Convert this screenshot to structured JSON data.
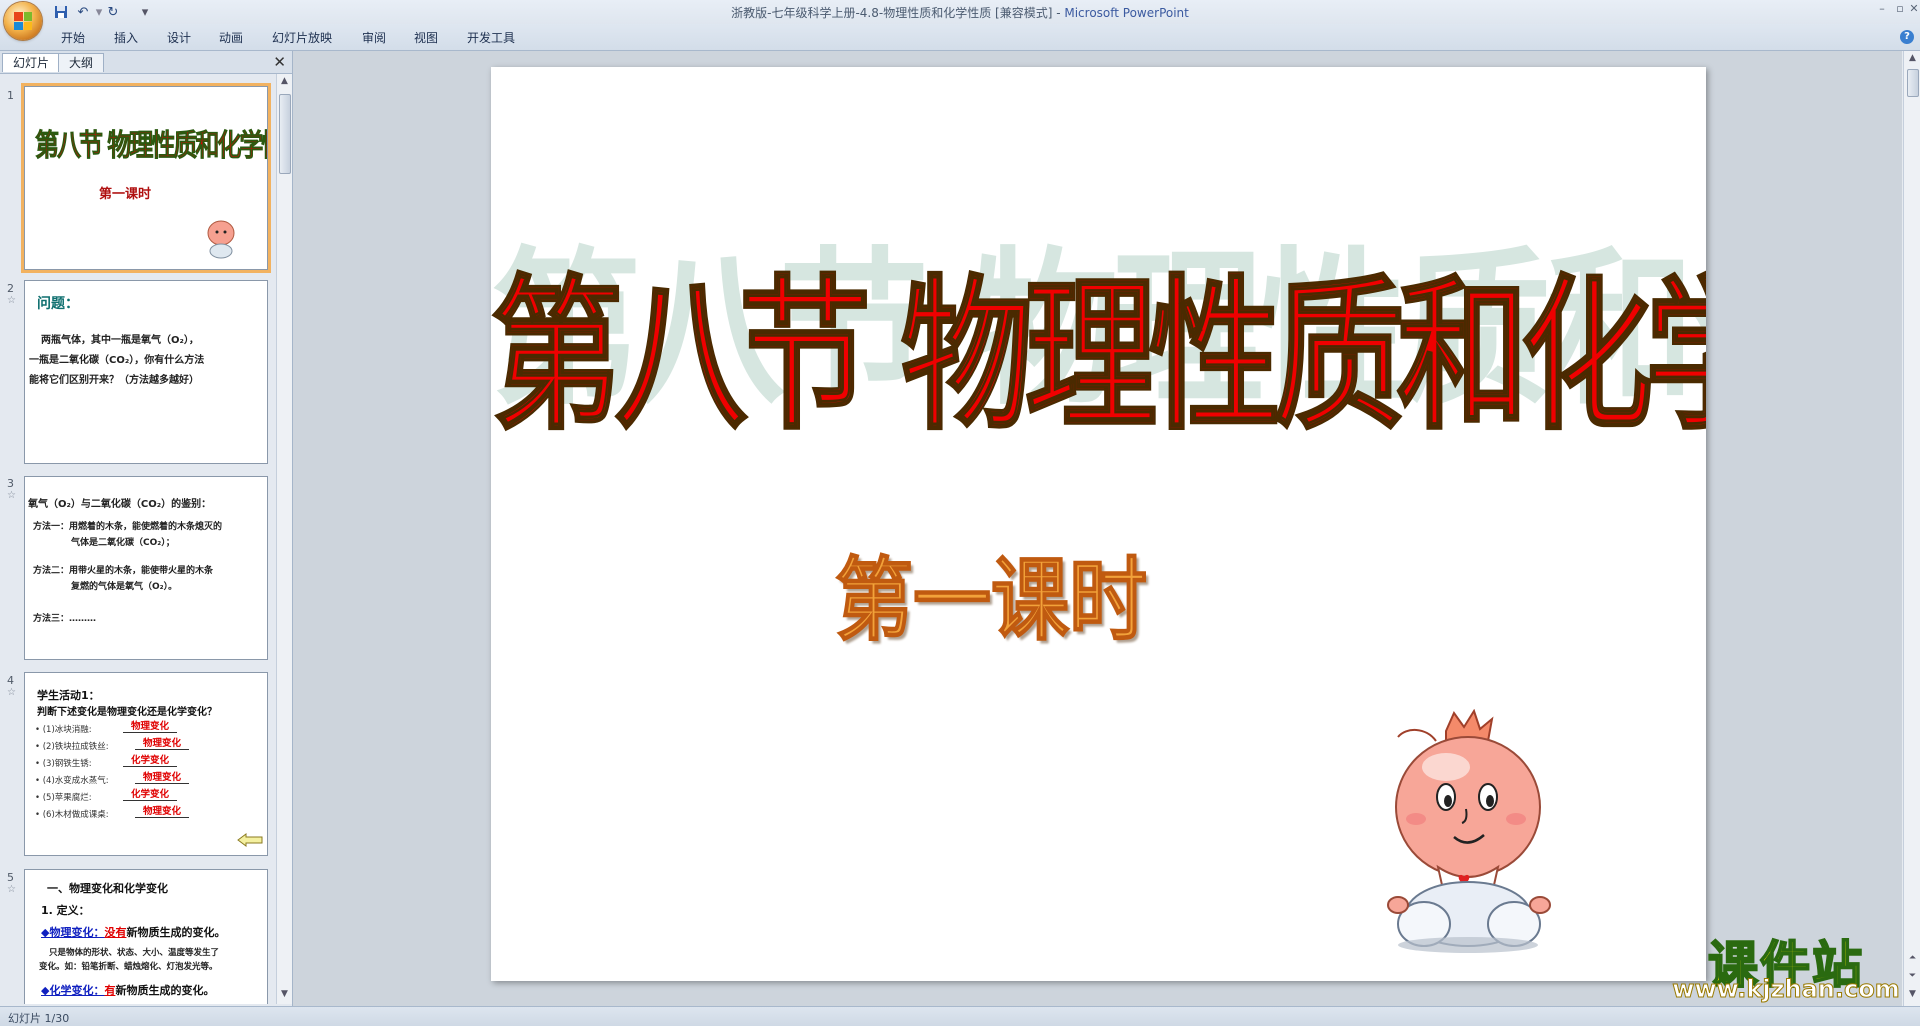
{
  "window": {
    "title": "浙教版-七年级科学上册-4.8-物理性质和化学性质 [兼容模式] - ",
    "app_name": "Microsoft PowerPoint",
    "qat": [
      "save-icon",
      "undo-icon",
      "redo-icon",
      "customize-icon"
    ]
  },
  "ribbon": {
    "tabs": [
      "开始",
      "插入",
      "设计",
      "动画",
      "幻灯片放映",
      "审阅",
      "视图",
      "开发工具"
    ]
  },
  "panel": {
    "tabs": [
      "幻灯片",
      "大纲"
    ],
    "close": "✕"
  },
  "thumbnails": [
    {
      "number": "1",
      "title": "第八节  物理性质和化学性质",
      "subtitle": "第一课时"
    },
    {
      "number": "2",
      "heading": "问题：",
      "lines": [
        "两瓶气体，其中一瓶是氧气（O₂），",
        "一瓶是二氧化碳（CO₂），你有什么方法",
        "能将它们区别开来？（方法越多越好）"
      ]
    },
    {
      "number": "3",
      "heading": "氧气（O₂）与二氧化碳（CO₂）的鉴别：",
      "lines": [
        "方法一：用燃着的木条，能使燃着的木条熄灭的",
        "气体是二氧化碳（CO₂）；",
        "方法二：用带火星的木条，能使带火星的木条",
        "复燃的气体是氧气（O₂）。",
        "方法三：………"
      ]
    },
    {
      "number": "4",
      "heading": "学生活动1：",
      "question": "判断下述变化是物理变化还是化学变化？",
      "items": [
        {
          "q": "(1)冰块消融:",
          "a": "物理变化"
        },
        {
          "q": "(2)铁块拉成铁丝:",
          "a": "物理变化"
        },
        {
          "q": "(3)钢铁生锈:",
          "a": "化学变化"
        },
        {
          "q": "(4)水变成水蒸气:",
          "a": "物理变化"
        },
        {
          "q": "(5)苹果腐烂:",
          "a": "化学变化"
        },
        {
          "q": "(6)木材做成课桌:",
          "a": "物理变化"
        }
      ]
    },
    {
      "number": "5",
      "heading": "一、物理变化和化学变化",
      "sub": "1. 定义：",
      "physical": "◆物理变化：",
      "physical_key": "没有",
      "physical_rest": "新物质生成的变化。",
      "note1": "只是物体的形状、状态、大小、温度等发生了",
      "note2": "变化。如：铅笔折断、蜡烛熔化、灯泡发光等。",
      "chemical": "◆化学变化：",
      "chemical_key": "有",
      "chemical_rest": "新物质生成的变化。"
    }
  ],
  "slide": {
    "title": "第八节  物理性质和化学性质",
    "subtitle": "第一课时"
  },
  "status": {
    "text": "幻灯片 1/30"
  },
  "watermark": {
    "text": "课件站",
    "url": "www.kjzhan.com"
  },
  "colors": {
    "title_red": "#f00000",
    "subtitle_orange": "#f2a23a",
    "selection": "#f2b260"
  }
}
